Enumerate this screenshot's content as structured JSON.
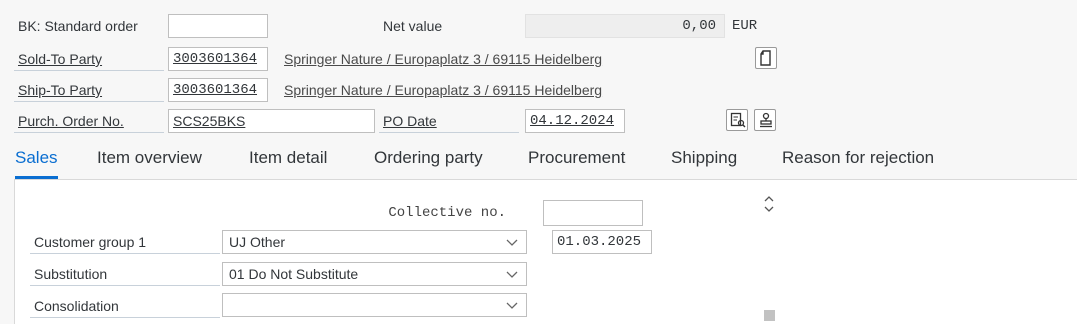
{
  "header": {
    "order_type": "BK: Standard order",
    "order_type_field": "",
    "net_value_label": "Net value",
    "net_value": "0,00",
    "currency": "EUR",
    "sold_to_label": "Sold-To Party",
    "sold_to_value": "3003601364",
    "sold_to_address": "Springer Nature / Europaplatz 3 / 69115 Heidelberg",
    "ship_to_label": "Ship-To Party",
    "ship_to_value": "3003601364",
    "ship_to_address": "Springer Nature / Europaplatz 3 / 69115 Heidelberg",
    "po_label": "Purch. Order No.",
    "po_value": "SCS25BKS",
    "po_date_label": "PO Date",
    "po_date_value": "04.12.2024"
  },
  "icons": {
    "document": "document-icon",
    "details": "details-icon",
    "stamp": "stamp-icon"
  },
  "tabs": [
    {
      "label": "Sales",
      "active": true
    },
    {
      "label": "Item overview",
      "active": false
    },
    {
      "label": "Item detail",
      "active": false
    },
    {
      "label": "Ordering party",
      "active": false
    },
    {
      "label": "Procurement",
      "active": false
    },
    {
      "label": "Shipping",
      "active": false
    },
    {
      "label": "Reason for rejection",
      "active": false
    }
  ],
  "sales": {
    "collective_label": "Collective no.",
    "collective_value": "",
    "customer_group_label": "Customer group 1",
    "customer_group_value": "UJ Other",
    "customer_group_date": "01.03.2025",
    "substitution_label": "Substitution",
    "substitution_value": "01 Do Not Substitute",
    "consolidation_label": "Consolidation",
    "consolidation_value": ""
  },
  "colors": {
    "accent": "#0a6ed1",
    "background": "#f7f7f7",
    "panel": "#ffffff"
  }
}
